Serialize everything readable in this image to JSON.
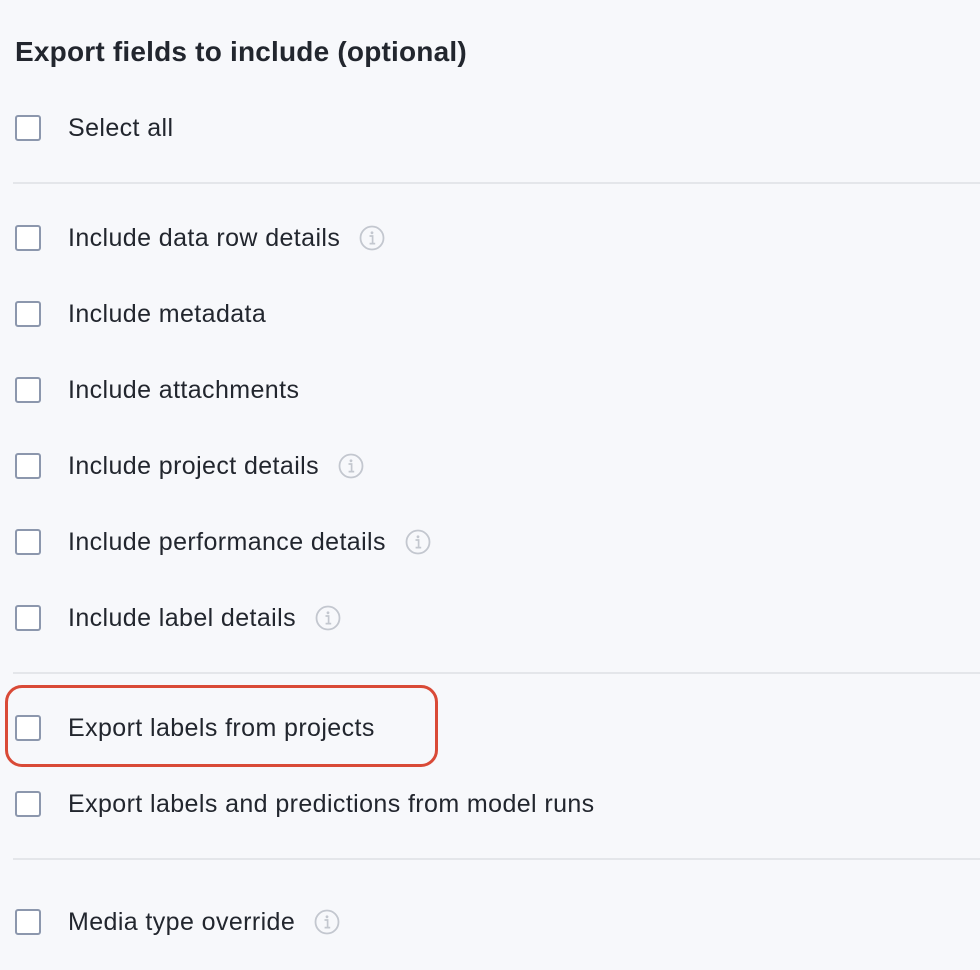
{
  "section": {
    "title": "Export fields to include (optional)"
  },
  "options": {
    "select_all": {
      "label": "Select all",
      "checked": false
    },
    "data_row_details": {
      "label": "Include data row details",
      "checked": false,
      "info_icon": "info-circle-icon"
    },
    "metadata": {
      "label": "Include metadata",
      "checked": false
    },
    "attachments": {
      "label": "Include attachments",
      "checked": false
    },
    "project_details": {
      "label": "Include project details",
      "checked": false,
      "info_icon": "info-circle-icon"
    },
    "performance_details": {
      "label": "Include performance details",
      "checked": false,
      "info_icon": "info-circle-icon"
    },
    "label_details": {
      "label": "Include label details",
      "checked": false,
      "info_icon": "info-circle-icon"
    },
    "labels_from_projects": {
      "label": "Export labels from projects",
      "checked": false
    },
    "labels_predictions_model_runs": {
      "label": "Export labels and predictions from model runs",
      "checked": false
    },
    "media_type_override": {
      "label": "Media type override",
      "checked": false,
      "info_icon": "info-circle-icon"
    }
  },
  "colors": {
    "background": "#f7f8fb",
    "text": "#22262e",
    "checkbox_border": "#8c97ad",
    "divider": "#e4e6ea",
    "info_icon": "#c3c7cf",
    "highlight": "#d94a37"
  }
}
